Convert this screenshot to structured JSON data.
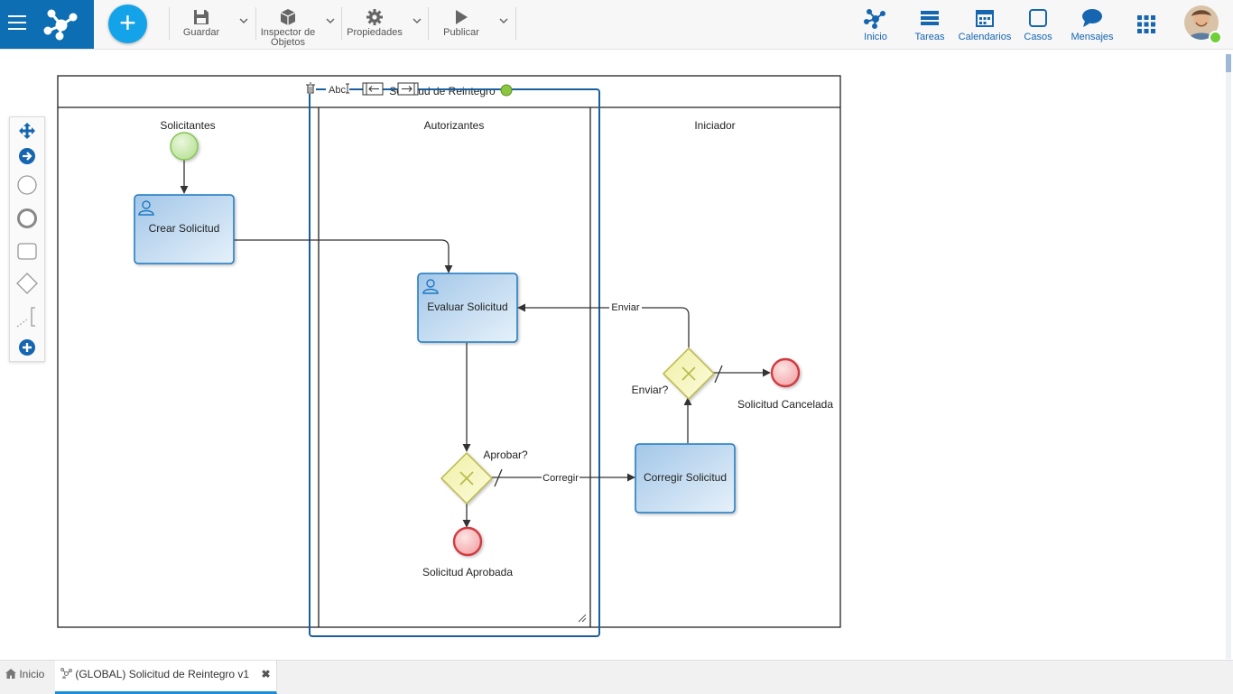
{
  "toolbar": {
    "new_button_symbol": "+",
    "save_label": "Guardar",
    "inspector_label_line1": "Inspector de",
    "inspector_label_line2": "Objetos",
    "properties_label": "Propiedades",
    "publish_label": "Publicar",
    "icons": [
      "menu-icon",
      "app-logo-icon",
      "plus-icon",
      "save-icon",
      "cube-icon",
      "gear-icon",
      "play-icon",
      "chevron-down-icon"
    ]
  },
  "nav": {
    "home": "Inicio",
    "tasks": "Tareas",
    "calendars": "Calendarios",
    "cases": "Casos",
    "messages": "Mensajes"
  },
  "diagram": {
    "pool_title": "Solicitud de Reintegro",
    "edit_label_tool": "Abc",
    "lanes": [
      "Solicitantes",
      "Autorizantes",
      "Iniciador"
    ],
    "tasks": {
      "create": "Crear Solicitud",
      "evaluate": "Evaluar Solicitud",
      "correct": "Corregir Solicitud"
    },
    "gateways": {
      "approve": "Aprobar?",
      "send": "Enviar?"
    },
    "flows": {
      "correct": "Corregir",
      "send": "Enviar"
    },
    "end_events": {
      "approved": "Solicitud Aprobada",
      "cancelled": "Solicitud Cancelada"
    }
  },
  "colors": {
    "brand_blue": "#0d6eb4",
    "fab_blue": "#14a3e8",
    "nav_blue": "#1565b0",
    "selection_blue": "#1a5f9c",
    "task_fill": "#b9d6ee",
    "gateway_fill": "#f3f3b6",
    "start_fill": "#c9ecaf",
    "end_fill": "#f7b9bb"
  },
  "bottom_tabs": {
    "home": "Inicio",
    "process": "(GLOBAL) Solicitud de Reintegro v1",
    "close_symbol": "✖"
  }
}
